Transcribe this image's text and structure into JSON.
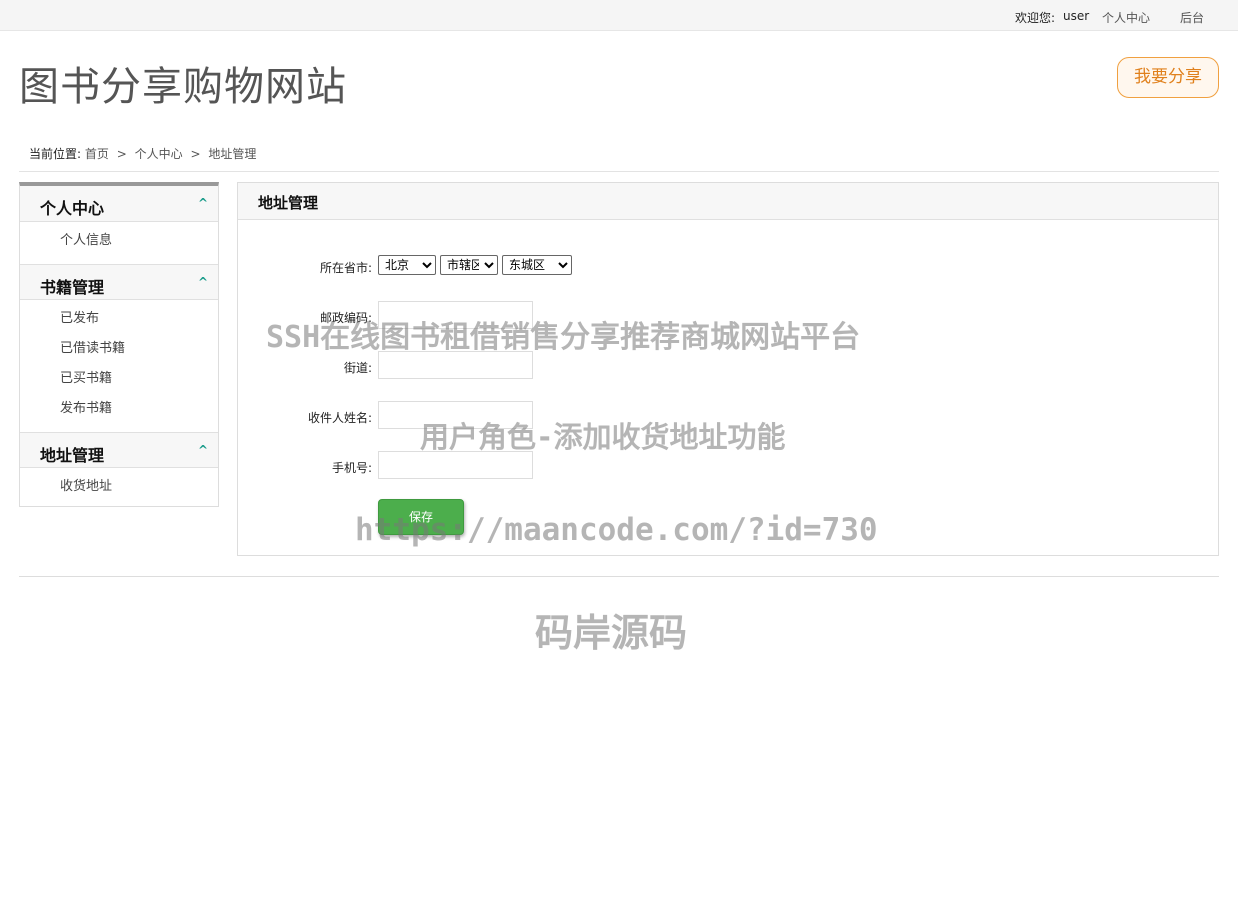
{
  "topbar": {
    "welcome": "欢迎您:",
    "username": "user",
    "personal_center": "个人中心",
    "backend": "后台"
  },
  "header": {
    "site_title": "图书分享购物网站",
    "share_button": "我要分享"
  },
  "breadcrumb": {
    "label": "当前位置:",
    "items": [
      "首页",
      "个人中心",
      "地址管理"
    ],
    "separator": ">"
  },
  "sidebar": {
    "sections": [
      {
        "title": "个人中心",
        "items": [
          "个人信息"
        ]
      },
      {
        "title": "书籍管理",
        "items": [
          "已发布",
          "已借读书籍",
          "已买书籍",
          "发布书籍"
        ]
      },
      {
        "title": "地址管理",
        "items": [
          "收货地址"
        ]
      }
    ],
    "chevron": "^"
  },
  "main": {
    "title": "地址管理",
    "form": {
      "region_label": "所在省市:",
      "province": "北京",
      "city": "市辖区",
      "district": "东城区",
      "postcode_label": "邮政编码:",
      "street_label": "街道:",
      "recipient_label": "收件人姓名:",
      "phone_label": "手机号:",
      "save_button": "保存"
    }
  },
  "watermarks": {
    "line1": "SSH在线图书租借销售分享推荐商城网站平台",
    "line2": "用户角色-添加收货地址功能",
    "line3": "https://maancode.com/?id=730",
    "line4": "码岸源码"
  },
  "colors": {
    "accent_orange": "#e0801c",
    "save_green": "#4cae4c",
    "chevron_teal": "#1a9c8a"
  }
}
